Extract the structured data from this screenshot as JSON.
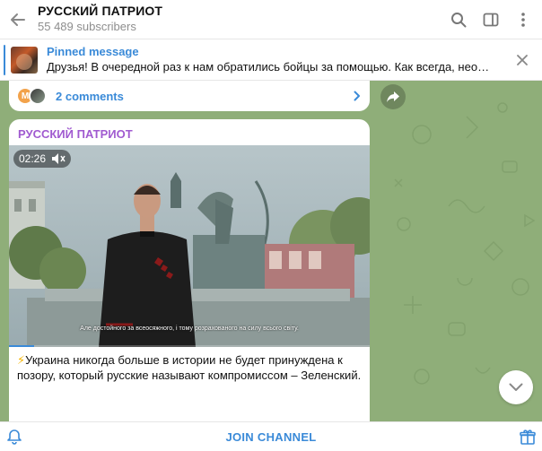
{
  "header": {
    "title": "РУССКИЙ ПАТРИОТ",
    "subscribers": "55 489 subscribers",
    "icons": [
      "back-arrow-icon",
      "search-icon",
      "sidebar-toggle-icon",
      "more-vertical-icon"
    ]
  },
  "pinned": {
    "label": "Pinned message",
    "text": "Друзья! В очередной раз к нам обратились бойцы за помощью. Как всегда, необхо..."
  },
  "comments": {
    "avatar_letter": "M",
    "label": "2 comments"
  },
  "message": {
    "author": "РУССКИЙ ПАТРИОТ",
    "video_duration": "02:26",
    "video_progress": 0.07,
    "video_subtitle": "Але достойного за всеосяжного, і тому розрахованого на силу всього світу.",
    "text": "Украина никогда больше в истории не будет принуждена к позору, который русские называют компромиссом – Зеленский.",
    "bolt": "⚡",
    "truncated": "· · · · · ·"
  },
  "bottom": {
    "join_label": "JOIN CHANNEL"
  },
  "colors": {
    "accent": "#3a8ad8",
    "author": "#a05ad0",
    "chat_bg": "#8fae79"
  }
}
